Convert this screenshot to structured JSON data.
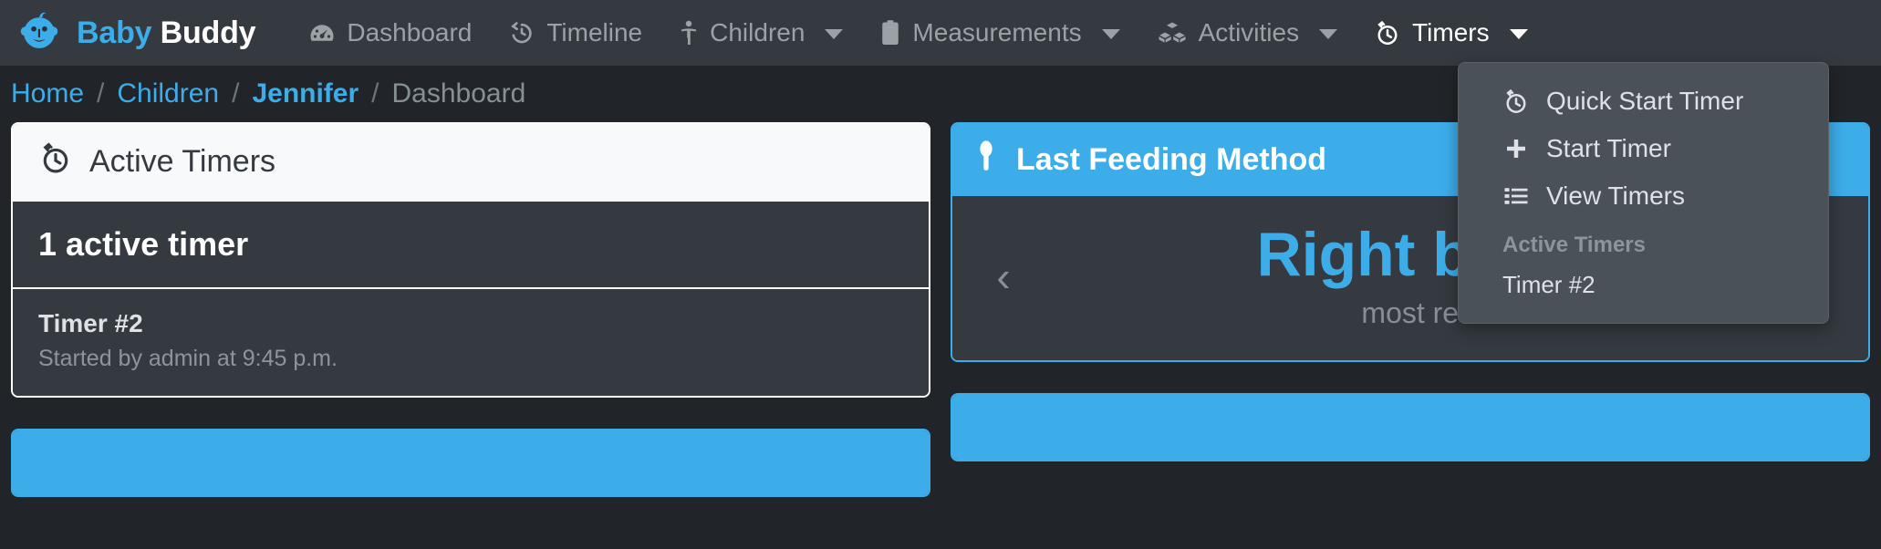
{
  "brand": {
    "word1": "Baby",
    "word2": "Buddy",
    "icon": "baby-face-icon"
  },
  "navbar": {
    "items": [
      {
        "label": "Dashboard",
        "icon": "dashboard-icon",
        "has_caret": false,
        "active": false
      },
      {
        "label": "Timeline",
        "icon": "history-icon",
        "has_caret": false,
        "active": false
      },
      {
        "label": "Children",
        "icon": "child-icon",
        "has_caret": true,
        "active": false
      },
      {
        "label": "Measurements",
        "icon": "clipboard-icon",
        "has_caret": true,
        "active": false
      },
      {
        "label": "Activities",
        "icon": "blocks-icon",
        "has_caret": true,
        "active": false
      },
      {
        "label": "Timers",
        "icon": "stopwatch-icon",
        "has_caret": true,
        "active": true
      }
    ]
  },
  "timers_dropdown": {
    "items": [
      {
        "label": "Quick Start Timer",
        "icon": "stopwatch-icon"
      },
      {
        "label": "Start Timer",
        "icon": "plus-icon"
      },
      {
        "label": "View Timers",
        "icon": "list-icon"
      }
    ],
    "section_header": "Active Timers",
    "active_timers": [
      {
        "label": "Timer #2"
      }
    ]
  },
  "breadcrumb": {
    "home": "Home",
    "children": "Children",
    "child": "Jennifer",
    "current": "Dashboard",
    "separator": "/"
  },
  "active_timers_card": {
    "title": "Active Timers",
    "icon": "stopwatch-icon",
    "count_text": "1 active timer",
    "timers": [
      {
        "name": "Timer #2",
        "detail": "Started by admin at 9:45 p.m."
      }
    ]
  },
  "last_feeding_method_card": {
    "title": "Last Feeding Method",
    "icon": "spoon-icon",
    "prev_arrow": "‹",
    "value": "Right breast",
    "subtitle": "most recent"
  },
  "colors": {
    "accent": "#3dadea",
    "navbar_bg": "#343a40",
    "page_bg": "#212529",
    "dropdown_bg": "#4b5158",
    "muted_text": "#868e96",
    "card_head_light": "#f8f9fa"
  }
}
